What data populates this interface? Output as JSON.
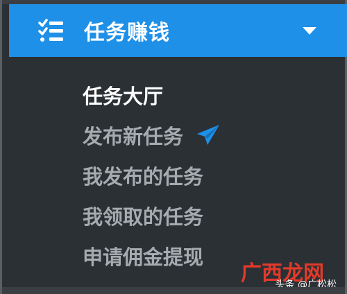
{
  "header": {
    "title": "任务赚钱",
    "icon": "task-list-icon",
    "chevron_icon": "caret-down-icon",
    "background_color": "#1e90e8"
  },
  "menu": {
    "items": [
      {
        "label": "任务大厅",
        "active": true
      },
      {
        "label": "发布新任务",
        "icon": "paper-plane-icon",
        "icon_color": "#1e90e8"
      },
      {
        "label": "我发布的任务"
      },
      {
        "label": "我领取的任务"
      },
      {
        "label": "申请佣金提现"
      }
    ]
  },
  "watermark": {
    "text": "头条 @广松松",
    "logo_text": "广西龙网"
  }
}
